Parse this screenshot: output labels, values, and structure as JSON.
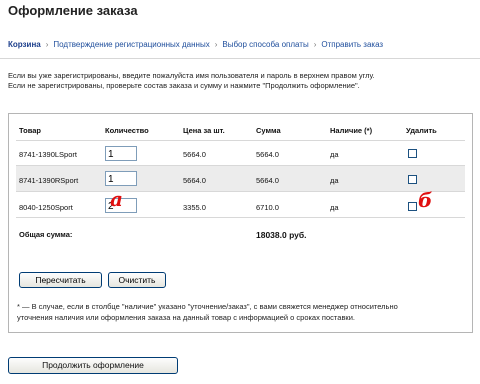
{
  "page_title": "Оформление заказа",
  "breadcrumbs": [
    "Корзина",
    "Подтверждение регистрационных данных",
    "Выбор способа оплаты",
    "Отправить заказ"
  ],
  "breadcrumb_separator": "›",
  "intro_lines": [
    "Если вы уже зарегистрированы, введите пожалуйста имя пользователя и пароль в верхнем правом углу.",
    "Если не зарегистрированы, проверьте состав заказа и сумму и нажмите \"Продолжить оформление\"."
  ],
  "table": {
    "headers": [
      "Товар",
      "Количество",
      "Цена за шт.",
      "Сумма",
      "Наличие (*)",
      "Удалить"
    ],
    "rows": [
      {
        "product": "8741-1390LSport",
        "qty": "1",
        "price": "5664.0",
        "sum": "5664.0",
        "stock": "да"
      },
      {
        "product": "8741-1390RSport",
        "qty": "1",
        "price": "5664.0",
        "sum": "5664.0",
        "stock": "да"
      },
      {
        "product": "8040-1250Sport",
        "qty": "2",
        "price": "3355.0",
        "sum": "6710.0",
        "stock": "да"
      }
    ],
    "total_label": "Общая сумма:",
    "total_value": "18038.0 руб."
  },
  "buttons": {
    "recalc": "Пересчитать",
    "clear": "Очистить",
    "continue": "Продолжить оформление"
  },
  "footnote_lines": [
    "* — В случае, если в столбце \"наличие\" указано \"уточнение/заказ\", с вами свяжется менеджер относительно",
    "уточнения наличия или оформления заказа на данный товар с информацией о сроках поставки."
  ],
  "annotations": {
    "a": "а",
    "b": "б"
  },
  "colors": {
    "link": "#1f4e9c",
    "mark": "#e01010",
    "button_border": "#003c74"
  }
}
